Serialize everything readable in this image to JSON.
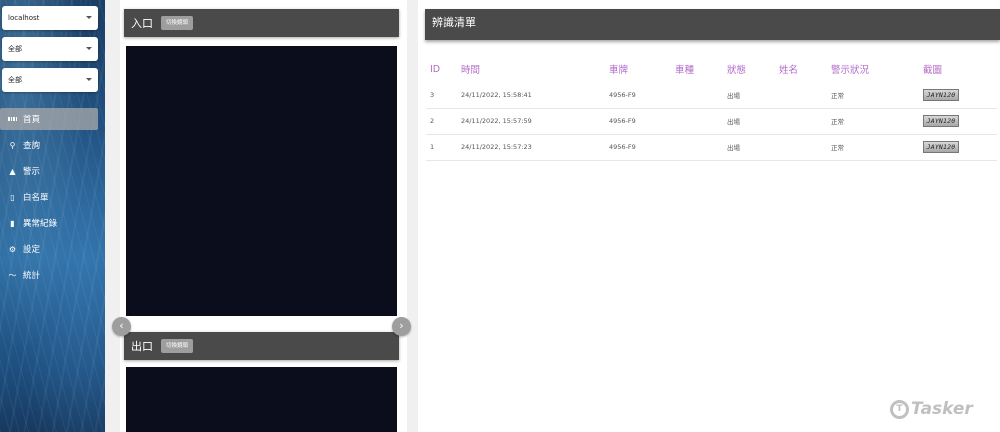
{
  "sidebar": {
    "selects": [
      {
        "value": "localhost"
      },
      {
        "value": "全部"
      },
      {
        "value": "全部"
      }
    ],
    "items": [
      {
        "label": "首頁",
        "icon": "dashboard-icon",
        "glyph": ""
      },
      {
        "label": "查詢",
        "icon": "search-icon",
        "glyph": "⚲"
      },
      {
        "label": "警示",
        "icon": "warning-icon",
        "glyph": "▲"
      },
      {
        "label": "白名單",
        "icon": "clipboard-icon",
        "glyph": "▯"
      },
      {
        "label": "異常紀錄",
        "icon": "book-icon",
        "glyph": "▮"
      },
      {
        "label": "設定",
        "icon": "gear-icon",
        "glyph": "⚙"
      },
      {
        "label": "統計",
        "icon": "trend-icon",
        "glyph": "〜"
      }
    ]
  },
  "entrance": {
    "title": "入口",
    "button": "切換鏡頭"
  },
  "exit": {
    "title": "出口",
    "button": "切換鏡頭"
  },
  "carousel": {
    "prev_glyph": "‹",
    "next_glyph": "›"
  },
  "records": {
    "title": "辨識清單",
    "columns": [
      "ID",
      "時間",
      "車牌",
      "車種",
      "狀態",
      "姓名",
      "警示狀況",
      "截圖"
    ],
    "rows": [
      {
        "id": "3",
        "time": "24/11/2022, 15:58:41",
        "plate": "4956-F9",
        "type": "",
        "status": "出場",
        "name": "",
        "alert": "正常",
        "snapshot": "JAYN120"
      },
      {
        "id": "2",
        "time": "24/11/2022, 15:57:59",
        "plate": "4956-F9",
        "type": "",
        "status": "出場",
        "name": "",
        "alert": "正常",
        "snapshot": "JAYN120"
      },
      {
        "id": "1",
        "time": "24/11/2022, 15:57:23",
        "plate": "4956-F9",
        "type": "",
        "status": "出場",
        "name": "",
        "alert": "正常",
        "snapshot": "JAYN120"
      }
    ]
  },
  "watermark": {
    "text": "Tasker",
    "glyph": "T"
  },
  "colors": {
    "header": "#4a4a4a",
    "column_header": "#b36bc9",
    "video": "#0c0d1c"
  }
}
